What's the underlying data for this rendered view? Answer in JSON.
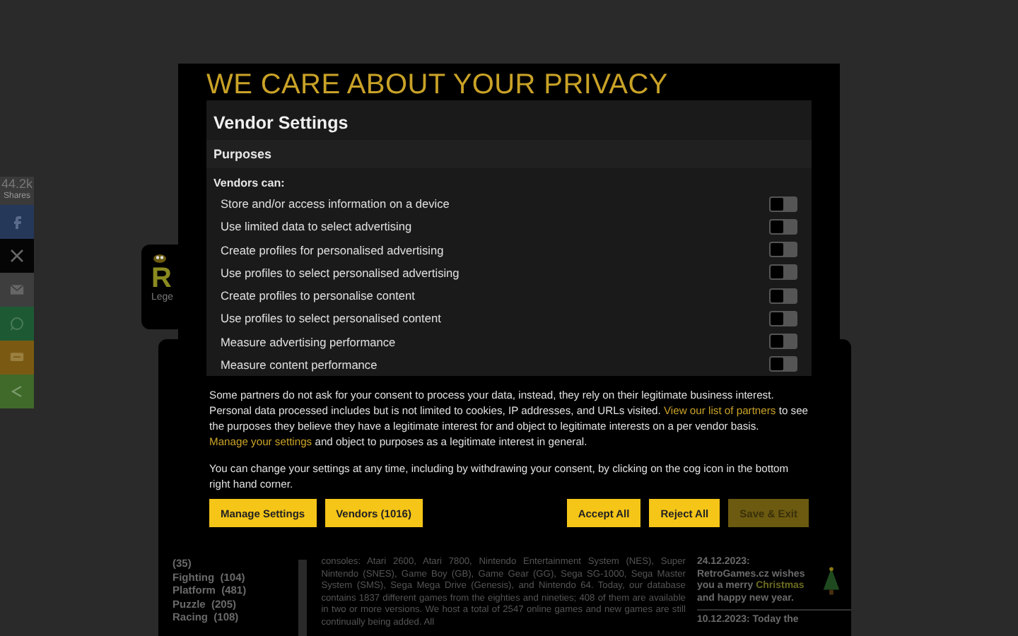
{
  "share_bar": {
    "count": "44.2k",
    "count_label": "Shares",
    "buttons": [
      {
        "kind": "facebook",
        "color": "#25385a"
      },
      {
        "kind": "x",
        "color": "#050505"
      },
      {
        "kind": "mail",
        "color": "#3e3e3e"
      },
      {
        "kind": "whatsapp",
        "color": "#1d5a34"
      },
      {
        "kind": "sms",
        "color": "#7a5a12"
      },
      {
        "kind": "share",
        "color": "#3f6a2a"
      }
    ]
  },
  "logo": {
    "letter": "R",
    "caption": "Lege"
  },
  "page": {
    "genres": [
      "(35)",
      "Fighting  (104)",
      "Platform  (481)",
      "Puzzle  (205)",
      "Racing  (108)"
    ],
    "intro": "consoles: Atari 2600, Atari 7800, Nintendo Entertainment System (NES), Super Nintendo (SNES), Game Boy (GB), Game Gear (GG), Sega SG-1000, Sega Master System (SMS), Sega Mega Drive (Genesis), and Nintendo 64. Today, our database contains 1837 different games from the eighties and nineties; 408 of them are available in two or more versions. We host a total of 2547 online games and new games are still continually being added. All",
    "news": [
      {
        "date": "24.12.2023:",
        "before": "RetroGames.cz wishes you a merry ",
        "highlight": "Christmas",
        "after": " and happy new year."
      }
    ],
    "next_news": "10.12.2023: Today the"
  },
  "dialog": {
    "title": "WE CARE ABOUT YOUR PRIVACY",
    "panel_title": "Vendor Settings",
    "section": "Purposes",
    "list_label": "Vendors can:",
    "purposes": [
      {
        "label": "Store and/or access information on a device",
        "on": false
      },
      {
        "label": "Use limited data to select advertising",
        "on": false
      },
      {
        "label": "Create profiles for personalised advertising",
        "on": false
      },
      {
        "label": "Use profiles to select personalised advertising",
        "on": false
      },
      {
        "label": "Create profiles to personalise content",
        "on": false
      },
      {
        "label": "Use profiles to select personalised content",
        "on": false
      },
      {
        "label": "Measure advertising performance",
        "on": false
      },
      {
        "label": "Measure content performance",
        "on": false
      }
    ],
    "paragraphs": [
      [
        {
          "kind": "text",
          "text": "Some partners do not ask for your consent to process your data, instead, they rely on their legitimate business interest. Personal data processed includes but is not limited to cookies, IP addresses, and URLs visited. "
        },
        {
          "kind": "link",
          "text": "View our list of partners"
        },
        {
          "kind": "text",
          "text": " to see the purposes they believe they have a legitimate interest for and object to legitimate interests on a per vendor basis. "
        },
        {
          "kind": "link",
          "text": "Manage your settings"
        },
        {
          "kind": "text",
          "text": " and object to purposes as a legitimate interest in general."
        }
      ],
      [
        {
          "kind": "text",
          "text": "You can change your settings at any time, including by withdrawing your consent, by clicking on the cog icon in the bottom right hand corner."
        }
      ]
    ],
    "buttons_left": [
      {
        "label": "Manage Settings",
        "disabled": false
      },
      {
        "label": "Vendors (1016)",
        "disabled": false
      }
    ],
    "buttons_right": [
      {
        "label": "Accept All",
        "disabled": false
      },
      {
        "label": "Reject All",
        "disabled": false
      },
      {
        "label": "Save & Exit",
        "disabled": true
      }
    ]
  }
}
